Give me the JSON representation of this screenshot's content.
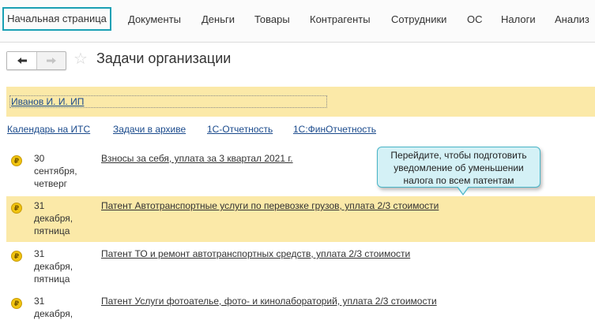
{
  "nav": {
    "items": [
      {
        "label": "Начальная страница",
        "active": true
      },
      {
        "label": "Документы"
      },
      {
        "label": "Деньги"
      },
      {
        "label": "Товары"
      },
      {
        "label": "Контрагенты"
      },
      {
        "label": "Сотрудники"
      },
      {
        "label": "ОС"
      },
      {
        "label": "Налоги"
      },
      {
        "label": "Анализ"
      }
    ]
  },
  "header": {
    "title": "Задачи организации",
    "back_icon": "arrow-left-icon",
    "forward_icon": "arrow-right-icon",
    "favorite_icon": "star-icon"
  },
  "organization": {
    "name": "Иванов И. И. ИП"
  },
  "links": [
    {
      "label": "Календарь на ИТС"
    },
    {
      "label": "Задачи в архиве"
    },
    {
      "label": "1С-Отчетность"
    },
    {
      "label": "1С:ФинОтчетность"
    }
  ],
  "tasks": [
    {
      "day": "30",
      "month": "сентября,",
      "weekday": "четверг",
      "title": "Взносы за себя, уплата за 3 квартал 2021 г.",
      "icon": "ruble-coin-icon"
    },
    {
      "day": "31",
      "month": "декабря,",
      "weekday": "пятница",
      "title": "Патент Автотранспортные услуги по перевозке грузов, уплата 2/3 стоимости",
      "icon": "ruble-coin-icon",
      "highlighted": true
    },
    {
      "day": "31",
      "month": "декабря,",
      "weekday": "пятница",
      "title": "Патент ТО и ремонт автотранспортных средств, уплата 2/3 стоимости",
      "icon": "ruble-coin-icon"
    },
    {
      "day": "31",
      "month": "декабря,",
      "weekday": "",
      "title": "Патент Услуги фотоателье, фото- и кинолабораторий, уплата 2/3 стоимости",
      "icon": "ruble-coin-icon"
    }
  ],
  "tooltip": {
    "line1": "Перейдите, чтобы подготовить",
    "line2": "уведомление об уменьшении",
    "line3": "налога по всем патентам"
  },
  "colors": {
    "accent": "#1aa0b4",
    "highlight": "#fbe9a8",
    "link": "#1a4a8c",
    "tooltip_bg": "#d4f1f6"
  }
}
